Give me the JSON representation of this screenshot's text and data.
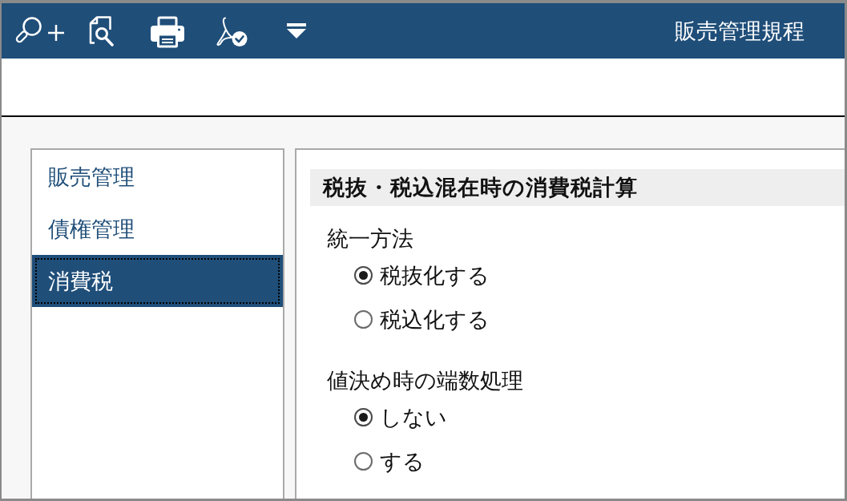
{
  "header": {
    "title": "販売管理規程"
  },
  "sidebar": {
    "items": [
      {
        "label": "販売管理",
        "selected": false
      },
      {
        "label": "債権管理",
        "selected": false
      },
      {
        "label": "消費税",
        "selected": true
      }
    ]
  },
  "section": {
    "title": "税抜・税込混在時の消費税計算",
    "groups": [
      {
        "label": "統一方法",
        "options": [
          {
            "label": "税抜化する",
            "selected": true
          },
          {
            "label": "税込化する",
            "selected": false
          }
        ]
      },
      {
        "label": "値決め時の端数処理",
        "options": [
          {
            "label": "しない",
            "selected": true
          },
          {
            "label": "する",
            "selected": false
          }
        ]
      }
    ]
  }
}
